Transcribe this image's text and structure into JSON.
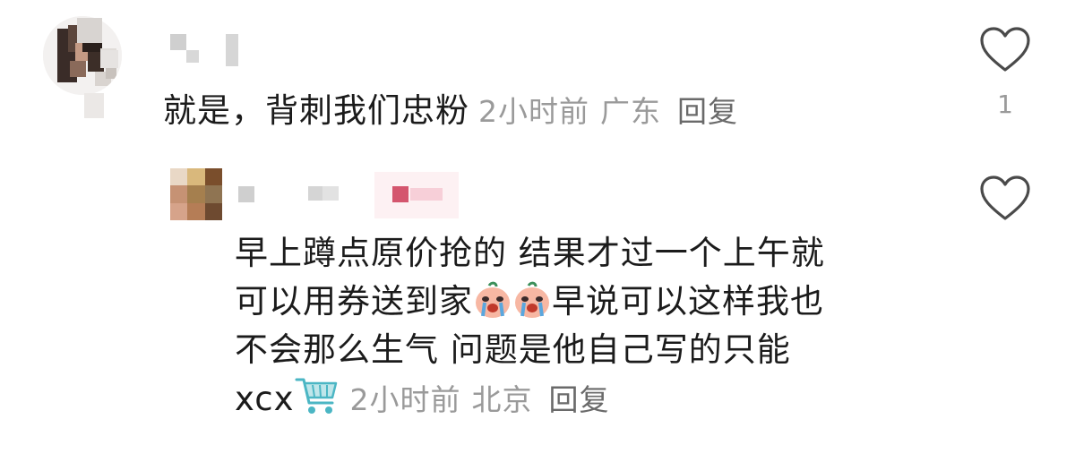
{
  "comment": {
    "text": "就是，背刺我们忠粉",
    "time": "2小时前",
    "location": "广东",
    "reply_label": "回复",
    "like_count": "1"
  },
  "reply": {
    "line1": "早上蹲点原价抢的 结果才过一个上午就",
    "line2_a": "可以用券送到家",
    "emojis": [
      "crying-face-emoji",
      "crying-face-emoji"
    ],
    "line2_b": "早说可以这样我也",
    "line3": "不会那么生气 问题是他自己写的只能",
    "line4_prefix": "xcx",
    "cart_icon": "shopping-cart-icon",
    "time": "2小时前",
    "location": "北京",
    "reply_label": "回复"
  },
  "colors": {
    "text": "#1b1b1b",
    "meta": "#9a9a9a",
    "reply": "#6a6a6a",
    "heart_stroke": "#4a4a4a",
    "cart": "#4bb6c4"
  }
}
